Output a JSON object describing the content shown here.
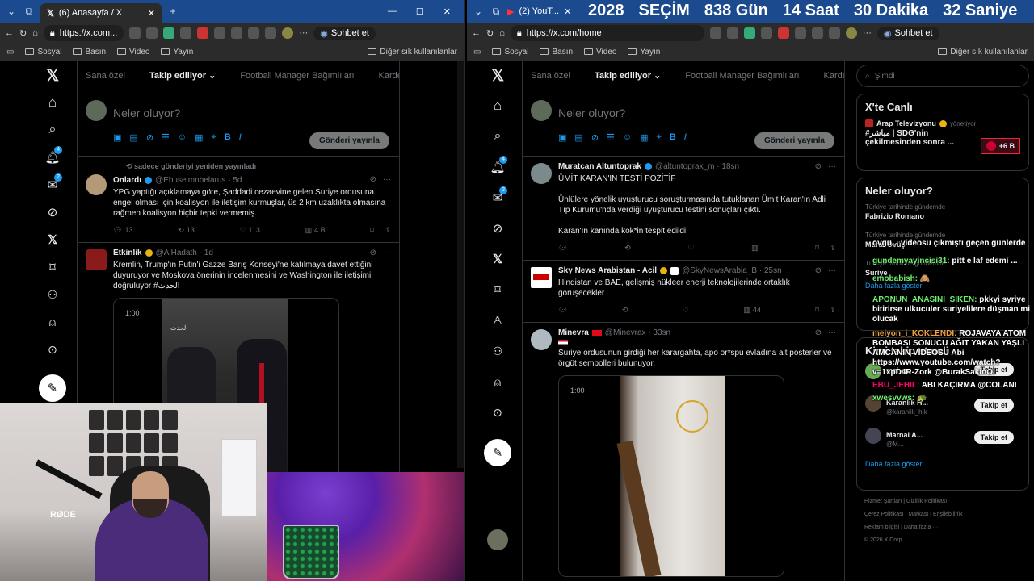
{
  "left": {
    "tab_title": "(6) Anasayfa / X",
    "url": "https://x.com...",
    "copilot": "Sohbet et",
    "bookmarks": [
      "Sosyal",
      "Basın",
      "Video",
      "Yayın"
    ],
    "bookmarks_more": "Diğer sık kullanılanlar",
    "nav_badges": {
      "notifications": "4",
      "messages": "2"
    },
    "tabs": [
      "Sana özel",
      "Takip ediliyor",
      "Football Manager Bağımlıları",
      "Kardeşler Kıraa"
    ],
    "compose_placeholder": "Neler oluyor?",
    "publish": "Gönderi yayınla",
    "tweets": [
      {
        "reposted": "sadece gönderiyi yeniden yayınladı",
        "name": "Onlardı",
        "handle": "@Ebuselmnbelarus · 5d",
        "text": "YPG yaptığı açıklamaya göre, Şaddadi cezaevine gelen Suriye ordusuna engel olması için koalisyon ile iletişim kurmuşlar, üs 2 km uzaklıkta olmasına rağmen koalisyon hiçbir tepki vermemiş.",
        "replies": "13",
        "retweets": "13",
        "likes": "113",
        "views": "4 B"
      },
      {
        "name": "Etkinlik",
        "handle": "@AlHadath · 1d",
        "text": "Kremlin, Trump'ın Putin'i Gazze Barış Konseyi'ne katılmaya davet ettiğini duyuruyor ve Moskova önerinin incelenmesini ve Washington ile iletişimi doğruluyor #الحدث",
        "duration": "1:00",
        "watermark": "الحدث"
      }
    ]
  },
  "right": {
    "tab_title": "(2) YouT...",
    "url": "https://x.com/home",
    "copilot": "Sohbet et",
    "countdown": [
      "2028",
      "SEÇİM",
      "838 Gün",
      "14 Saat",
      "30 Dakika",
      "32 Saniye"
    ],
    "bookmarks": [
      "Sosyal",
      "Basın",
      "Video",
      "Yayın"
    ],
    "bookmarks_more": "Diğer sık kullanılanlar",
    "nav_badges": {
      "notifications": "4",
      "messages": "2"
    },
    "tabs": [
      "Sana özel",
      "Takip ediliyor",
      "Football Manager Bağımlıları",
      "Kardeşler Kıraa"
    ],
    "compose_placeholder": "Neler oluyor?",
    "publish": "Gönderi yayınla",
    "tweets": [
      {
        "name": "Muratcan Altuntoprak",
        "handle": "@altuntoprak_m · 18sn",
        "text1": "ÜMİT KARAN'IN TESTİ POZİTİF",
        "text2": "Ünlülere yönelik uyuşturucu soruşturmasında tutuklanan Ümit Karan'ın Adli Tıp Kurumu'nda verdiği uyuşturucu testini sonuçları çıktı.",
        "text3": "Karan'ın kanında kok*in tespit edildi."
      },
      {
        "name": "Sky News Arabistan - Acil",
        "handle": "@SkyNewsArabia_B · 25sn",
        "text": "Hindistan ve BAE, gelişmiş nükleer enerji teknolojilerinde ortaklık görüşecekler",
        "views": "44"
      },
      {
        "name": "Minevra",
        "handle": "@Minevrax · 33sn",
        "text": "Suriye ordusunun girdiği her karargahta, apo or*spu evladına ait posterler ve örgüt sembolleri bulunuyor.",
        "duration": "1:00"
      }
    ],
    "search_placeholder": "Şimdi",
    "live": {
      "title": "X'te Canlı",
      "host": "Arap Televizyonu",
      "host_role": "yönetiyor",
      "stream": "#مباشر | SDG'nin çekilmesinden sonra ...",
      "count": "+6 B"
    },
    "trends": {
      "title": "Neler oluyor?",
      "items": [
        {
          "meta": "Türkiye tarihinde gündemde",
          "name": "Fabrizio Romano"
        },
        {
          "meta": "Türkiye tarihinde gündemde",
          "name": "Murat Övüç"
        },
        {
          "meta": "Türkiye tarihinde gündemde",
          "name": "Suriye"
        }
      ],
      "more": "Daha fazla göster"
    },
    "who": {
      "title": "Kimi takip etmeli",
      "items": [
        {
          "name": "meiyon",
          "handle": "@..."
        },
        {
          "name": "Karanlık H...",
          "handle": "@karanlik_hik"
        },
        {
          "name": "Marnal A...",
          "handle": "@M..."
        }
      ],
      "follow": "Takip et",
      "more": "Daha fazla göster"
    },
    "footer": [
      "Hizmet Şartları",
      "Gizlilik Politikası",
      "Çerez Politikası",
      "Markası",
      "Erişilebilirlik",
      "Reklam bilgisi",
      "Daha fazla ···",
      "© 2026 X Corp."
    ],
    "chat": [
      {
        "user": "",
        "msg": "övgü... videosu çıkmıştı geçen günlerde"
      },
      {
        "user": "gundemyayincisi31:",
        "msg": "pitt e laf edemi ..."
      },
      {
        "user": "emobabish:",
        "msg": "🙈"
      },
      {
        "user": "APONUN_ANASINI_SIKEN:",
        "msg": "pkkyi syriye bitirirse ulkuculer suriyelilere düşman mi olucak"
      },
      {
        "user": "meiyon_i_KOKLENDI:",
        "msg": "ROJAVAYA ATOM BOMBASI SONUCU AĞIT YAKAN YAŞLI AMCANIN VİDEOSU Abi https://www.youtube.com/watch?v=1xpD4R-Zork @BurakSakinOl"
      },
      {
        "user": "EBU_JEHIL:",
        "msg": "ABI KAÇIRMA @COLANI"
      },
      {
        "user": "xwesvvws:",
        "msg": ""
      }
    ]
  },
  "cam": {
    "mic_brand": "RØDE"
  }
}
